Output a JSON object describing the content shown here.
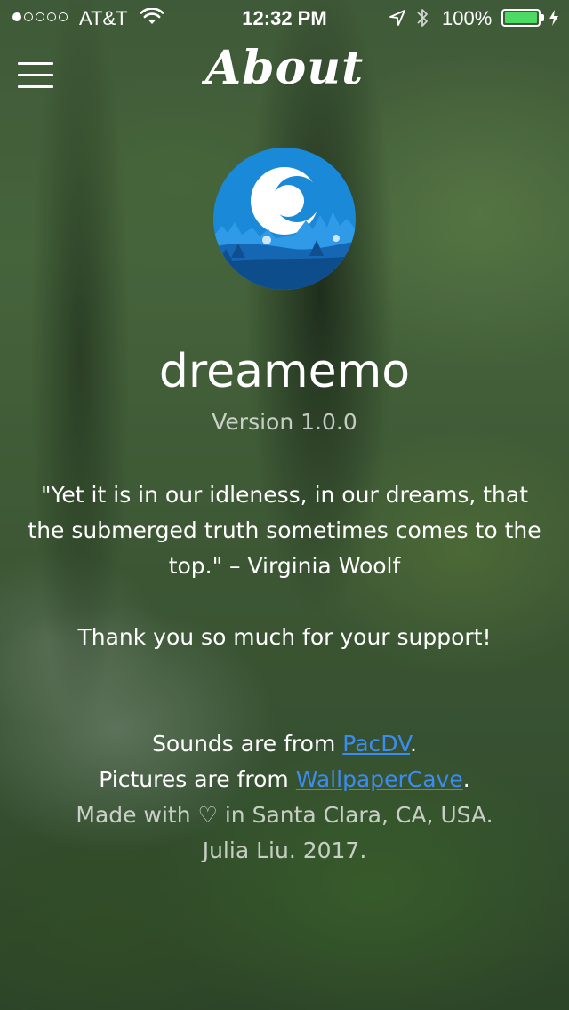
{
  "status_bar": {
    "carrier": "AT&T",
    "time": "12:32 PM",
    "battery_percent": "100%",
    "signal_bars_filled": 1,
    "signal_bars_total": 5,
    "battery_level": 1.0,
    "battery_color": "#4cd964",
    "icons": [
      "wifi-icon",
      "location-icon",
      "bluetooth-icon",
      "battery-icon",
      "charging-icon"
    ]
  },
  "nav": {
    "title": "About",
    "menu_icon": "hamburger-menu-icon"
  },
  "app": {
    "logo_icon": "dreamemo-logo",
    "name": "dreamemo",
    "version": "Version 1.0.0"
  },
  "quote": {
    "text": "\"Yet it is in our idleness, in our dreams, that the submerged truth sometimes comes to the top.\" – Virginia Woolf"
  },
  "thanks": "Thank you so much for your support!",
  "credits": {
    "sounds_prefix": "Sounds are from ",
    "sounds_link": "PacDV",
    "sounds_suffix": ".",
    "pictures_prefix": "Pictures are from ",
    "pictures_link": "WallpaperCave",
    "pictures_suffix": ".",
    "made_with": "Made with ♡ in Santa Clara, CA, USA.",
    "author": "Julia Liu. 2017."
  },
  "colors": {
    "link": "#3c8cf0",
    "logo_blue": "#1a8ad8"
  }
}
